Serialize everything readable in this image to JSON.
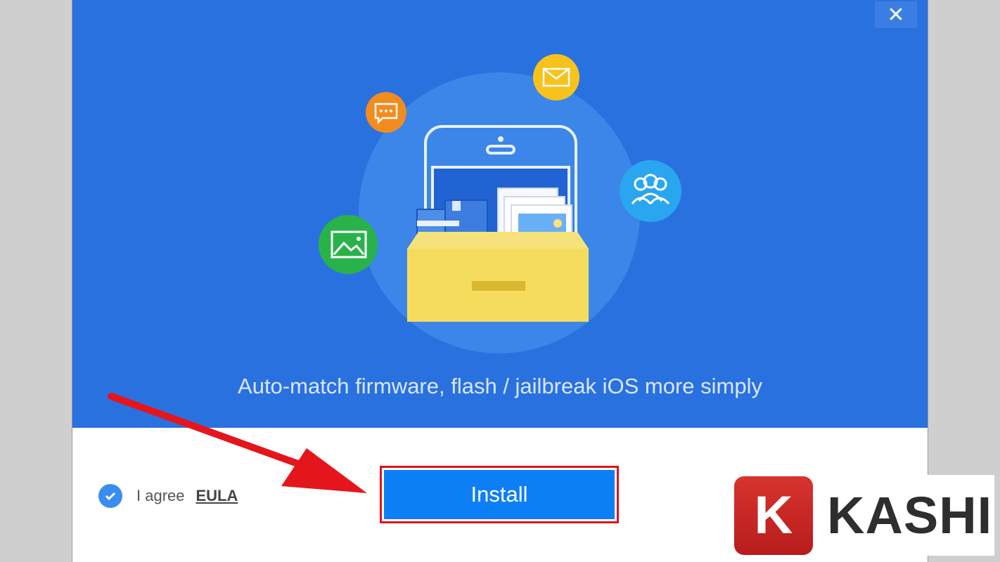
{
  "window": {
    "close_glyph": "✕",
    "tagline": "Auto-match firmware, flash / jailbreak iOS more simply"
  },
  "footer": {
    "agree_label": "I agree",
    "eula_link": "EULA",
    "install_label": "Install"
  },
  "icons": [
    "chat-bubble-icon",
    "mail-icon",
    "users-icon",
    "image-icon",
    "phone-icon",
    "drawer-icon",
    "check-icon"
  ],
  "watermark": {
    "badge_letter": "K",
    "text": "KASHI"
  },
  "colors": {
    "banner": "#2a71e0",
    "install": "#0d7ff6",
    "highlight": "#e0121c",
    "chat_badge": "#f28c1e",
    "mail_badge": "#f7c21b",
    "users_badge": "#2aa6f0",
    "image_badge": "#2ab24a"
  }
}
